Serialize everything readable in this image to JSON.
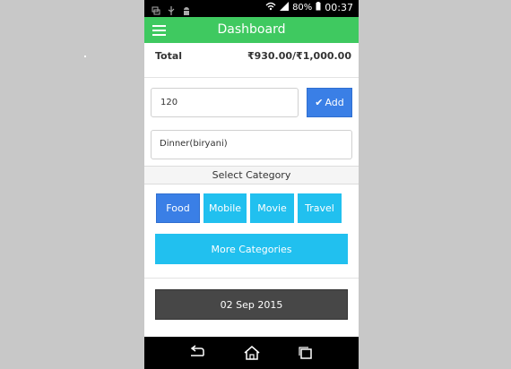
{
  "status_bar": {
    "battery": "80%",
    "time": "00:37"
  },
  "app_bar": {
    "title": "Dashboard"
  },
  "summary": {
    "label": "Total",
    "value": "₹930.00/₹1,000.00"
  },
  "amount_input": {
    "value": "120"
  },
  "add_button": {
    "label": "Add"
  },
  "description_input": {
    "value": "Dinner(biryani)"
  },
  "category_section": {
    "title": "Select Category",
    "categories": [
      "Food",
      "Mobile",
      "Movie",
      "Travel"
    ],
    "selected": "Food",
    "more_label": "More Categories"
  },
  "date_button": {
    "label": "02 Sep 2015"
  },
  "colors": {
    "app_bar": "#3fc960",
    "primary_blue": "#3a7fe6",
    "category_cyan": "#21c0ef",
    "date_button": "#474747"
  },
  "icons": [
    "notification-icon",
    "usb-icon",
    "android-icon",
    "wifi-icon",
    "signal-icon",
    "battery-icon",
    "menu-icon",
    "check-icon",
    "back-icon",
    "home-icon",
    "recent-apps-icon"
  ]
}
